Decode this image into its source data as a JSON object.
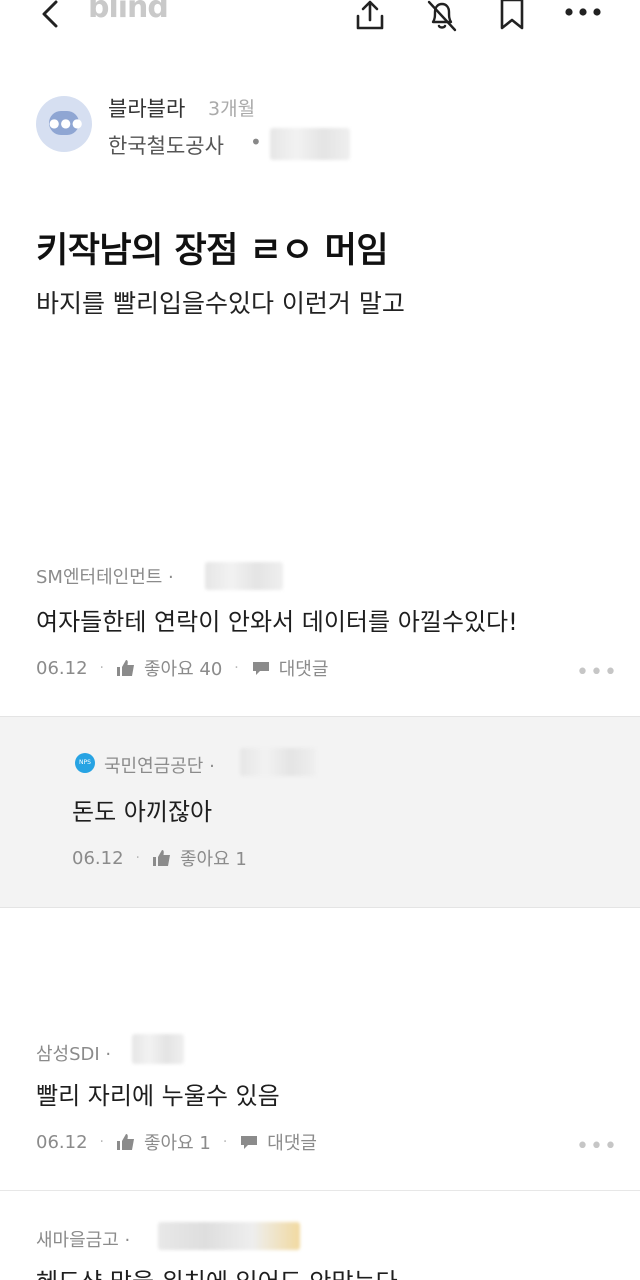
{
  "app": {
    "logo": "blind"
  },
  "icons": {
    "back": "chevron-left-icon",
    "share": "share-icon",
    "notification": "bell-off-icon",
    "bookmark": "bookmark-icon",
    "more": "more-horizontal-icon"
  },
  "post": {
    "author": "블라블라",
    "time": "3개월",
    "company": "한국철도공사",
    "dot": "•",
    "title": "키작남의 장점 ㄹㅇ 머임",
    "body": "바지를 빨리입을수있다 이런거 말고"
  },
  "comments": [
    {
      "company": "SM엔터테인먼트 ·",
      "text": "여자들한테 연락이 안와서 데이터를 아낄수있다!",
      "date": "06.12",
      "like_label": "좋아요 40",
      "reply_label": "대댓글"
    },
    {
      "company": "삼성SDI ·",
      "text": "빨리 자리에 누울수 있음",
      "date": "06.12",
      "like_label": "좋아요 1",
      "reply_label": "대댓글"
    },
    {
      "company": "새마을금고 ·",
      "text": "헤드샷 맞을 위치에 있어도 안맞는다"
    }
  ],
  "reply": {
    "company": "국민연금공단 ·",
    "text": "돈도 아끼잖아",
    "date": "06.12",
    "like_label": "좋아요 1"
  },
  "ui": {
    "sep": "·",
    "more": "•••"
  }
}
